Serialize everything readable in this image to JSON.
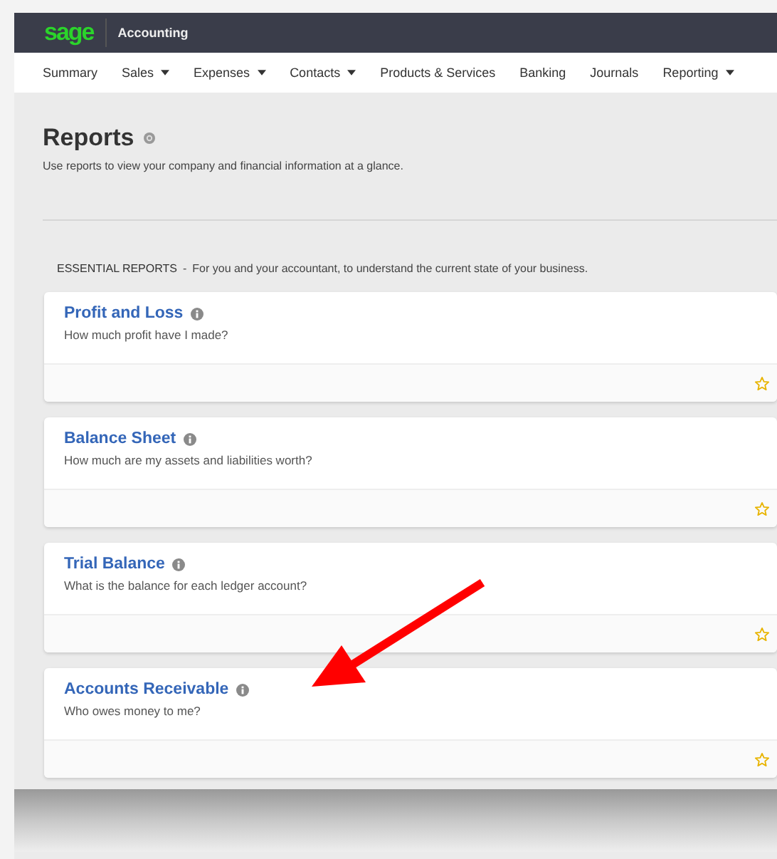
{
  "app": {
    "logo": "sage",
    "product": "Accounting"
  },
  "nav": [
    {
      "label": "Summary",
      "dropdown": false
    },
    {
      "label": "Sales",
      "dropdown": true
    },
    {
      "label": "Expenses",
      "dropdown": true
    },
    {
      "label": "Contacts",
      "dropdown": true
    },
    {
      "label": "Products & Services",
      "dropdown": false
    },
    {
      "label": "Banking",
      "dropdown": false
    },
    {
      "label": "Journals",
      "dropdown": false
    },
    {
      "label": "Reporting",
      "dropdown": true
    }
  ],
  "page": {
    "title": "Reports",
    "subtitle": "Use reports to view your company and financial information at a glance."
  },
  "section": {
    "heading": "ESSENTIAL REPORTS",
    "separator": "-",
    "description": "For you and your accountant, to understand the current state of your business."
  },
  "reports": [
    {
      "title": "Profit and Loss",
      "question": "How much profit have I made?",
      "favorite": false
    },
    {
      "title": "Balance Sheet",
      "question": "How much are my assets and liabilities worth?",
      "favorite": false
    },
    {
      "title": "Trial Balance",
      "question": "What is the balance for each ledger account?",
      "favorite": false
    },
    {
      "title": "Accounts Receivable",
      "question": "Who owes money to me?",
      "favorite": false
    }
  ]
}
